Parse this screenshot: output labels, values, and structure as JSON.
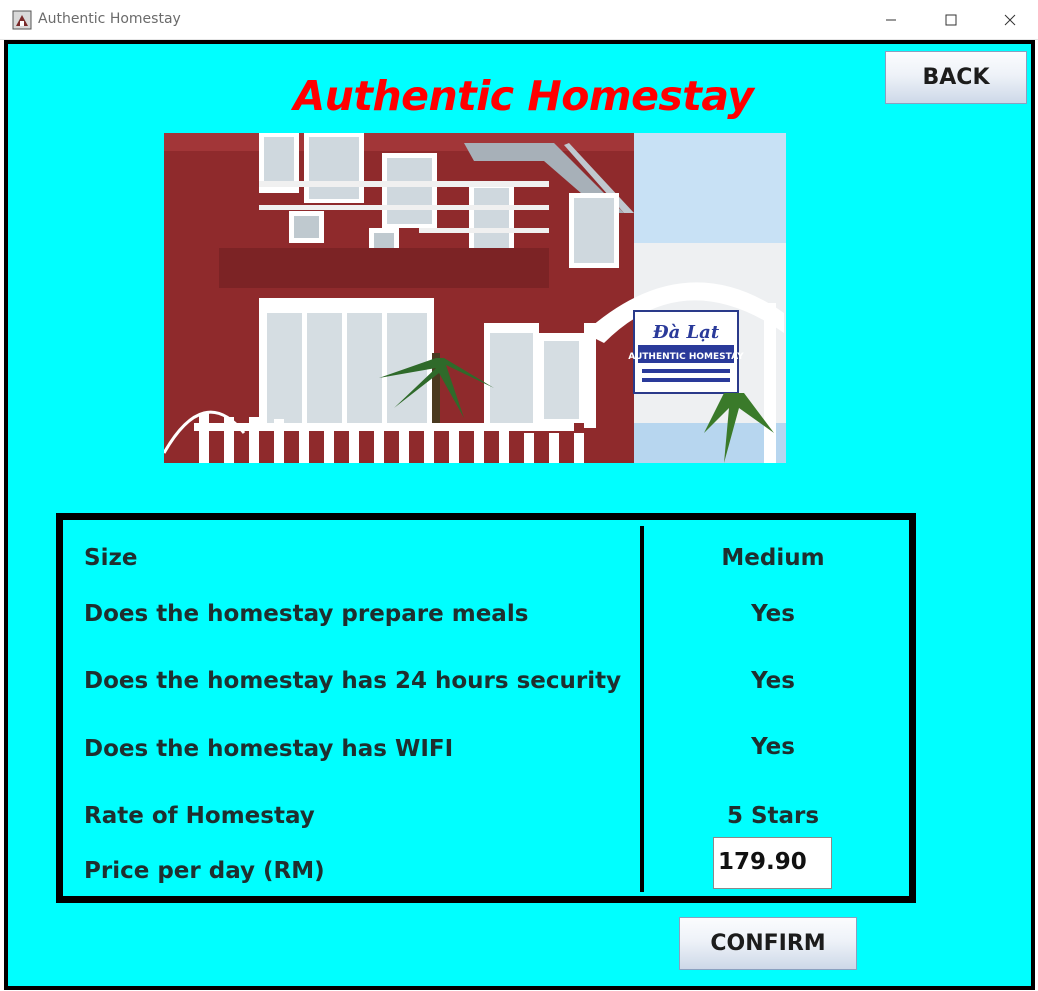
{
  "window": {
    "title": "Authentic Homestay",
    "minimize_icon": "minimize-icon",
    "maximize_icon": "maximize-icon",
    "close_icon": "close-icon"
  },
  "header": {
    "title": "Authentic Homestay",
    "title_color": "#ff0000",
    "back_label": "BACK"
  },
  "photo": {
    "description_icon": "homestay-photo",
    "sign_line1": "Đà Lạt",
    "sign_line2": "AUTHENTIC HOMESTAY"
  },
  "details": {
    "size_label": "Size",
    "size_value": "Medium",
    "meals_label": "Does the homestay prepare meals",
    "meals_value": "Yes",
    "security_label": "Does the homestay has 24 hours security",
    "security_value": "Yes",
    "wifi_label": "Does the homestay has WIFI",
    "wifi_value": "Yes",
    "rate_label": "Rate of Homestay",
    "rate_value": "5 Stars",
    "price_label": "Price per day (RM)",
    "price_value": "179.90"
  },
  "footer": {
    "confirm_label": "CONFIRM"
  },
  "colors": {
    "background": "#00ffff",
    "border": "#000000",
    "text": "#1f2f2f"
  }
}
